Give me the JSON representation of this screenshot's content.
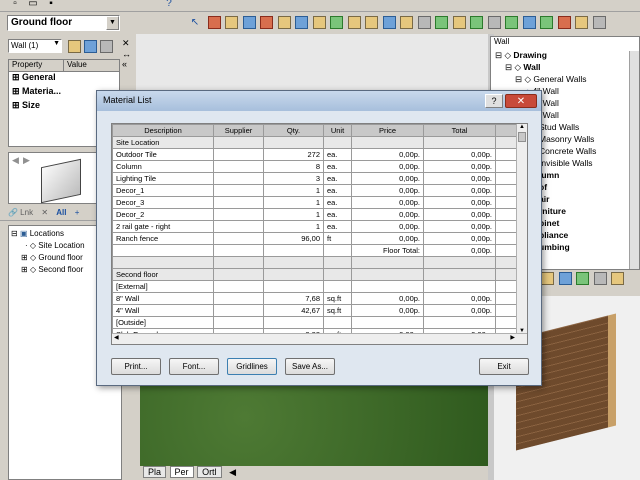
{
  "floor_select": "Ground floor",
  "left_panel": {
    "element_select": "Wall (1)",
    "columns": [
      "Property",
      "Value"
    ],
    "rows": [
      "General",
      "Materia...",
      "Size"
    ]
  },
  "locations_tree": {
    "root": "Locations",
    "items": [
      "Site Location",
      "Ground floor",
      "Second floor"
    ]
  },
  "right_panel": {
    "tree_title": "Wall",
    "items": [
      "Drawing",
      "Wall",
      "General Walls",
      "4\" Wall",
      "6\" Wall",
      "8\" Wall",
      "Stud Walls",
      "Masonry Walls",
      "Concrete Walls",
      "Invisible Walls",
      "lumn",
      "of",
      "air",
      "rniture",
      "binet",
      "pliance",
      "umbing"
    ]
  },
  "view_tabs": [
    "Pla",
    "Per",
    "Ortl"
  ],
  "dialog": {
    "title": "Material List",
    "columns": [
      "Description",
      "Supplier",
      "Qty.",
      "Unit",
      "Price",
      "Total"
    ],
    "rows": [
      {
        "type": "section",
        "desc": "Site Location"
      },
      {
        "desc": "Outdoor Tile",
        "qty": "272",
        "unit": "ea.",
        "price": "0,00p.",
        "total": "0,00p."
      },
      {
        "desc": "Column",
        "qty": "8",
        "unit": "ea.",
        "price": "0,00p.",
        "total": "0,00p."
      },
      {
        "desc": "Lighting Tile",
        "qty": "3",
        "unit": "ea.",
        "price": "0,00p.",
        "total": "0,00p."
      },
      {
        "desc": "Decor_1",
        "qty": "1",
        "unit": "ea.",
        "price": "0,00p.",
        "total": "0,00p."
      },
      {
        "desc": "Decor_3",
        "qty": "1",
        "unit": "ea.",
        "price": "0,00p.",
        "total": "0,00p."
      },
      {
        "desc": "Decor_2",
        "qty": "1",
        "unit": "ea.",
        "price": "0,00p.",
        "total": "0,00p."
      },
      {
        "desc": "2 rail gate - right",
        "qty": "1",
        "unit": "ea.",
        "price": "0,00p.",
        "total": "0,00p."
      },
      {
        "desc": "Ranch fence",
        "qty": "96,00",
        "unit": "ft",
        "price": "0,00p.",
        "total": "0,00p."
      },
      {
        "type": "floortotal",
        "price": "Floor Total:",
        "total": "0,00p."
      },
      {
        "type": "blank"
      },
      {
        "type": "section",
        "desc": "Second floor"
      },
      {
        "desc": "[External]",
        "qty": "",
        "unit": "",
        "price": "",
        "total": ""
      },
      {
        "desc": "8\" Wall",
        "qty": "7,68",
        "unit": "sq.ft",
        "price": "0,00p.",
        "total": "0,00p."
      },
      {
        "desc": "4\" Wall",
        "qty": "42,67",
        "unit": "sq.ft",
        "price": "0,00p.",
        "total": "0,00p."
      },
      {
        "desc": "[Outside]",
        "qty": "",
        "unit": "",
        "price": "",
        "total": ""
      },
      {
        "desc": "Slab Example",
        "qty": "2,33",
        "unit": "sq.ft",
        "price": "0,00p.",
        "total": "0,00p."
      }
    ],
    "buttons": {
      "print": "Print...",
      "font": "Font...",
      "gridlines": "Gridlines",
      "save": "Save As...",
      "exit": "Exit"
    }
  }
}
